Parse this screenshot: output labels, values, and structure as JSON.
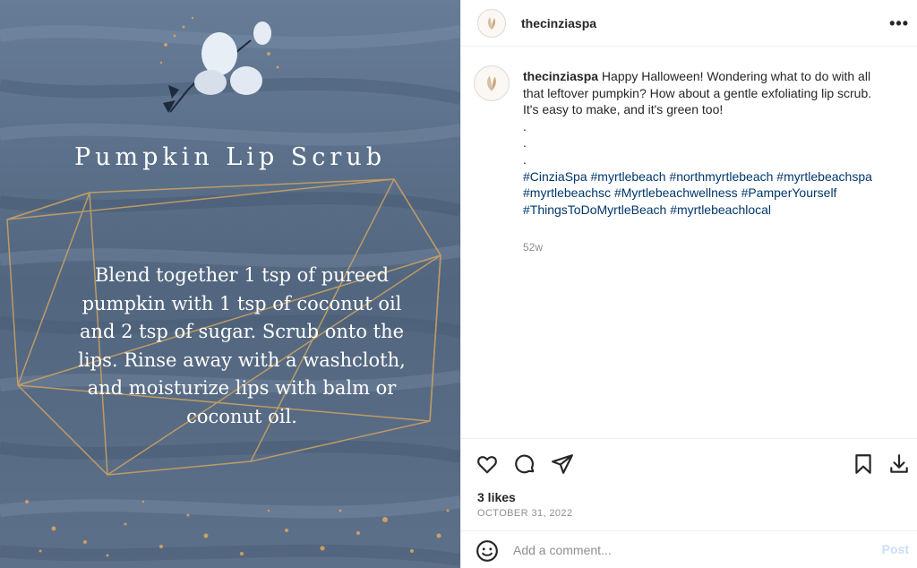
{
  "image": {
    "title": "Pumpkin Lip Scrub",
    "body": "Blend together 1 tsp of pureed pumpkin with 1 tsp of coconut oil and 2 tsp of sugar.  Scrub onto the lips. Rinse away with a washcloth, and moisturize lips with balm or coconut oil.",
    "background_color": "#5a6f8c",
    "accent_gold": "#c9a063"
  },
  "header": {
    "username": "thecinziaspa",
    "more_icon": "more-horizontal-icon"
  },
  "caption": {
    "username": "thecinziaspa",
    "text": "Happy Halloween! Wondering what to do with all that leftover pumpkin? How about a gentle exfoliating lip scrub. It's easy to make, and it's green too!",
    "dots": [
      ".",
      ".",
      "."
    ],
    "hashtags": [
      "#CinziaSpa",
      "#myrtlebeach",
      "#northmyrtlebeach",
      "#myrtlebeachspa",
      "#myrtlebeachsc",
      "#Myrtlebeachwellness",
      "#PamperYourself",
      "#ThingsToDoMyrtleBeach",
      "#myrtlebeachlocal"
    ],
    "time_ago": "52w",
    "hashtag_color": "#00376b"
  },
  "actions": {
    "icons": [
      "heart-icon",
      "comment-icon",
      "share-icon",
      "bookmark-icon",
      "download-icon"
    ],
    "likes": "3 likes",
    "date": "OCTOBER 31, 2022"
  },
  "comment": {
    "placeholder": "Add a comment...",
    "post_label": "Post",
    "emoji_icon": "emoji-icon",
    "post_color": "#c7dffa"
  }
}
